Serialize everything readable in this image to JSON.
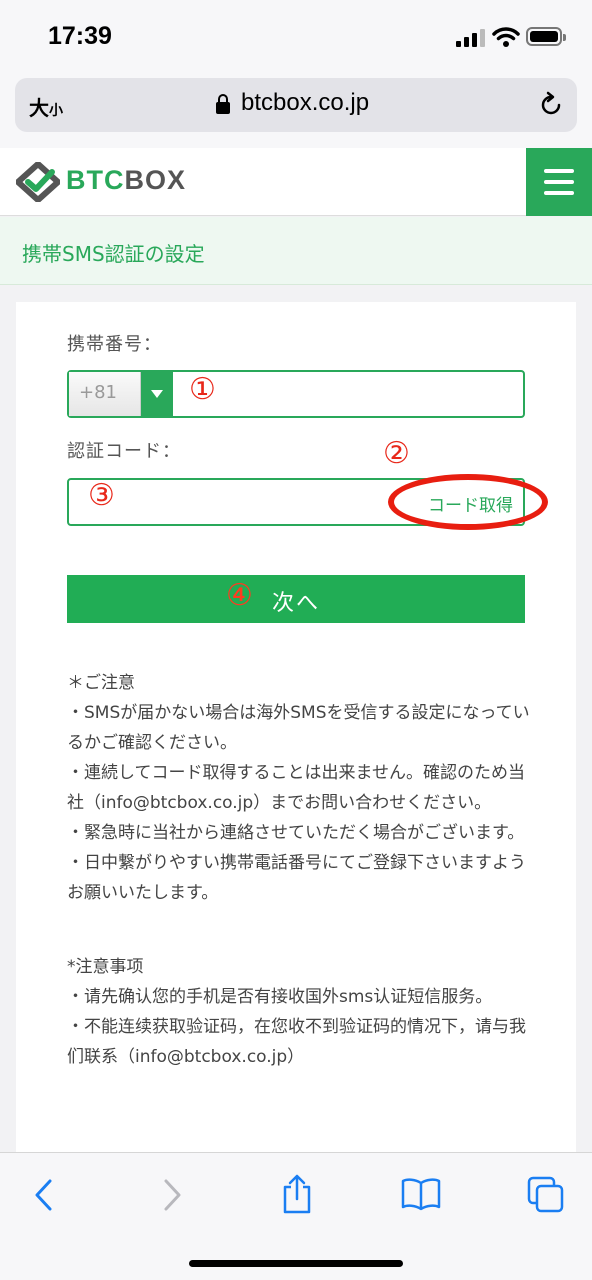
{
  "status": {
    "time": "17:39"
  },
  "browser": {
    "text_size_label": "大",
    "text_size_small": "小",
    "domain": "btcbox.co.jp"
  },
  "site": {
    "logo_btc": "BTC",
    "logo_box": "BOX",
    "page_title": "携帯SMS認証の設定"
  },
  "form": {
    "phone_label": "携帯番号：",
    "country_code": "+81",
    "code_label": "認証コード：",
    "get_code_button": "コード取得",
    "next_button": "次へ"
  },
  "annotations": {
    "m1": "①",
    "m2": "②",
    "m3": "③",
    "m4": "④"
  },
  "notes_ja": [
    "＊ご注意",
    "・SMSが届かない場合は海外SMSを受信する設定になっているかご確認ください。",
    "・連続してコード取得することは出来ません。確認のため当社（info@btcbox.co.jp）までお問い合わせください。",
    "・緊急時に当社から連絡させていただく場合がございます。",
    "・日中繋がりやすい携帯電話番号にてご登録下さいますようお願いいたします。"
  ],
  "notes_zh": [
    "*注意事项",
    "・请先确认您的手机是否有接收国外sms认证短信服务。",
    "・不能连续获取验证码，在您收不到验证码的情况下，请与我们联系（info@btcbox.co.jp）"
  ],
  "colors": {
    "brand_green": "#29a85a",
    "annotation_red": "#e81e10"
  }
}
